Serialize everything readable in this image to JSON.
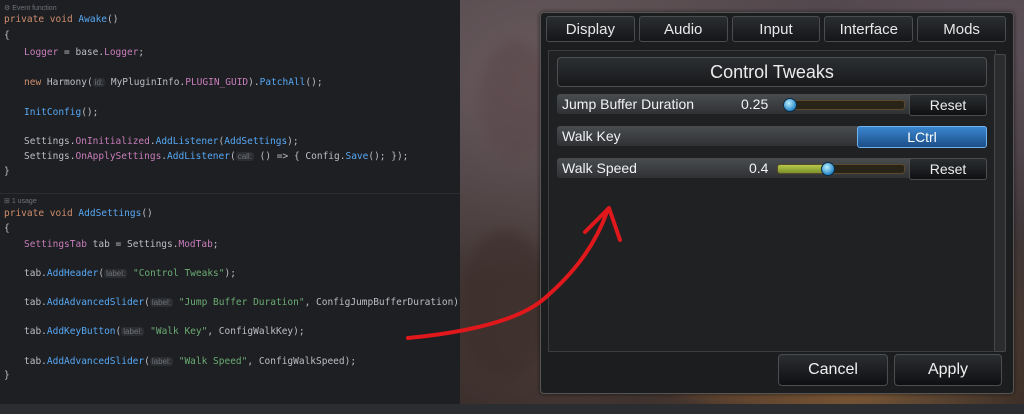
{
  "editor": {
    "hint_event": "Event function",
    "awake_sig": [
      "private",
      "void",
      "Awake",
      "()"
    ],
    "brace_open": "{",
    "brace_close": "}",
    "logger_line": [
      "Logger",
      " = base.",
      "Logger",
      ";"
    ],
    "harmony_line": [
      "new ",
      "Harmony",
      "(",
      "id:",
      " ",
      "MyPluginInfo",
      ".",
      "PLUGIN_GUID",
      ").",
      "PatchAll",
      "();"
    ],
    "init_line": [
      "InitConfig",
      "();"
    ],
    "oninit_line": [
      "Settings",
      ".",
      "OnInitialized",
      ".",
      "AddListener",
      "(",
      "AddSettings",
      ");"
    ],
    "onapply_line": [
      "Settings",
      ".",
      "OnApplySettings",
      ".",
      "AddListener",
      "(",
      "call:",
      " () => { ",
      "Config",
      ".",
      "Save",
      "(); });"
    ],
    "hint_usage": "1 usage",
    "addsettings_sig": [
      "private",
      "void",
      "AddSettings",
      "()"
    ],
    "tab_line": [
      "SettingsTab",
      " tab = ",
      "Settings",
      ".",
      "ModTab",
      ";"
    ],
    "header_line": [
      "tab.",
      "AddHeader",
      "(",
      "label:",
      " ",
      "\"Control Tweaks\"",
      ");"
    ],
    "slider1_line": [
      "tab.",
      "AddAdvancedSlider",
      "(",
      "label:",
      " ",
      "\"Jump Buffer Duration\"",
      ", ",
      "ConfigJumpBufferDuration",
      ");"
    ],
    "key_line": [
      "tab.",
      "AddKeyButton",
      "(",
      "label:",
      " ",
      "\"Walk Key\"",
      ", ",
      "ConfigWalkKey",
      ");"
    ],
    "slider2_line": [
      "tab.",
      "AddAdvancedSlider",
      "(",
      "label:",
      " ",
      "\"Walk Speed\"",
      ", ",
      "ConfigWalkSpeed",
      ");"
    ]
  },
  "game": {
    "tabs": [
      "Display",
      "Audio",
      "Input",
      "Interface",
      "Mods"
    ],
    "header": "Control Tweaks",
    "rows": [
      {
        "label": "Jump Buffer Duration",
        "value": "0.25",
        "fraction": 0.05,
        "button": "Reset"
      },
      {
        "label": "Walk Key",
        "key": "LCtrl"
      },
      {
        "label": "Walk Speed",
        "value": "0.4",
        "fraction": 0.4,
        "button": "Reset"
      }
    ],
    "cancel": "Cancel",
    "apply": "Apply"
  },
  "colors": {
    "annotation_arrow": "#e0181c",
    "slider_fill": "#9fb33a",
    "key_button": "#2f6fb0"
  }
}
